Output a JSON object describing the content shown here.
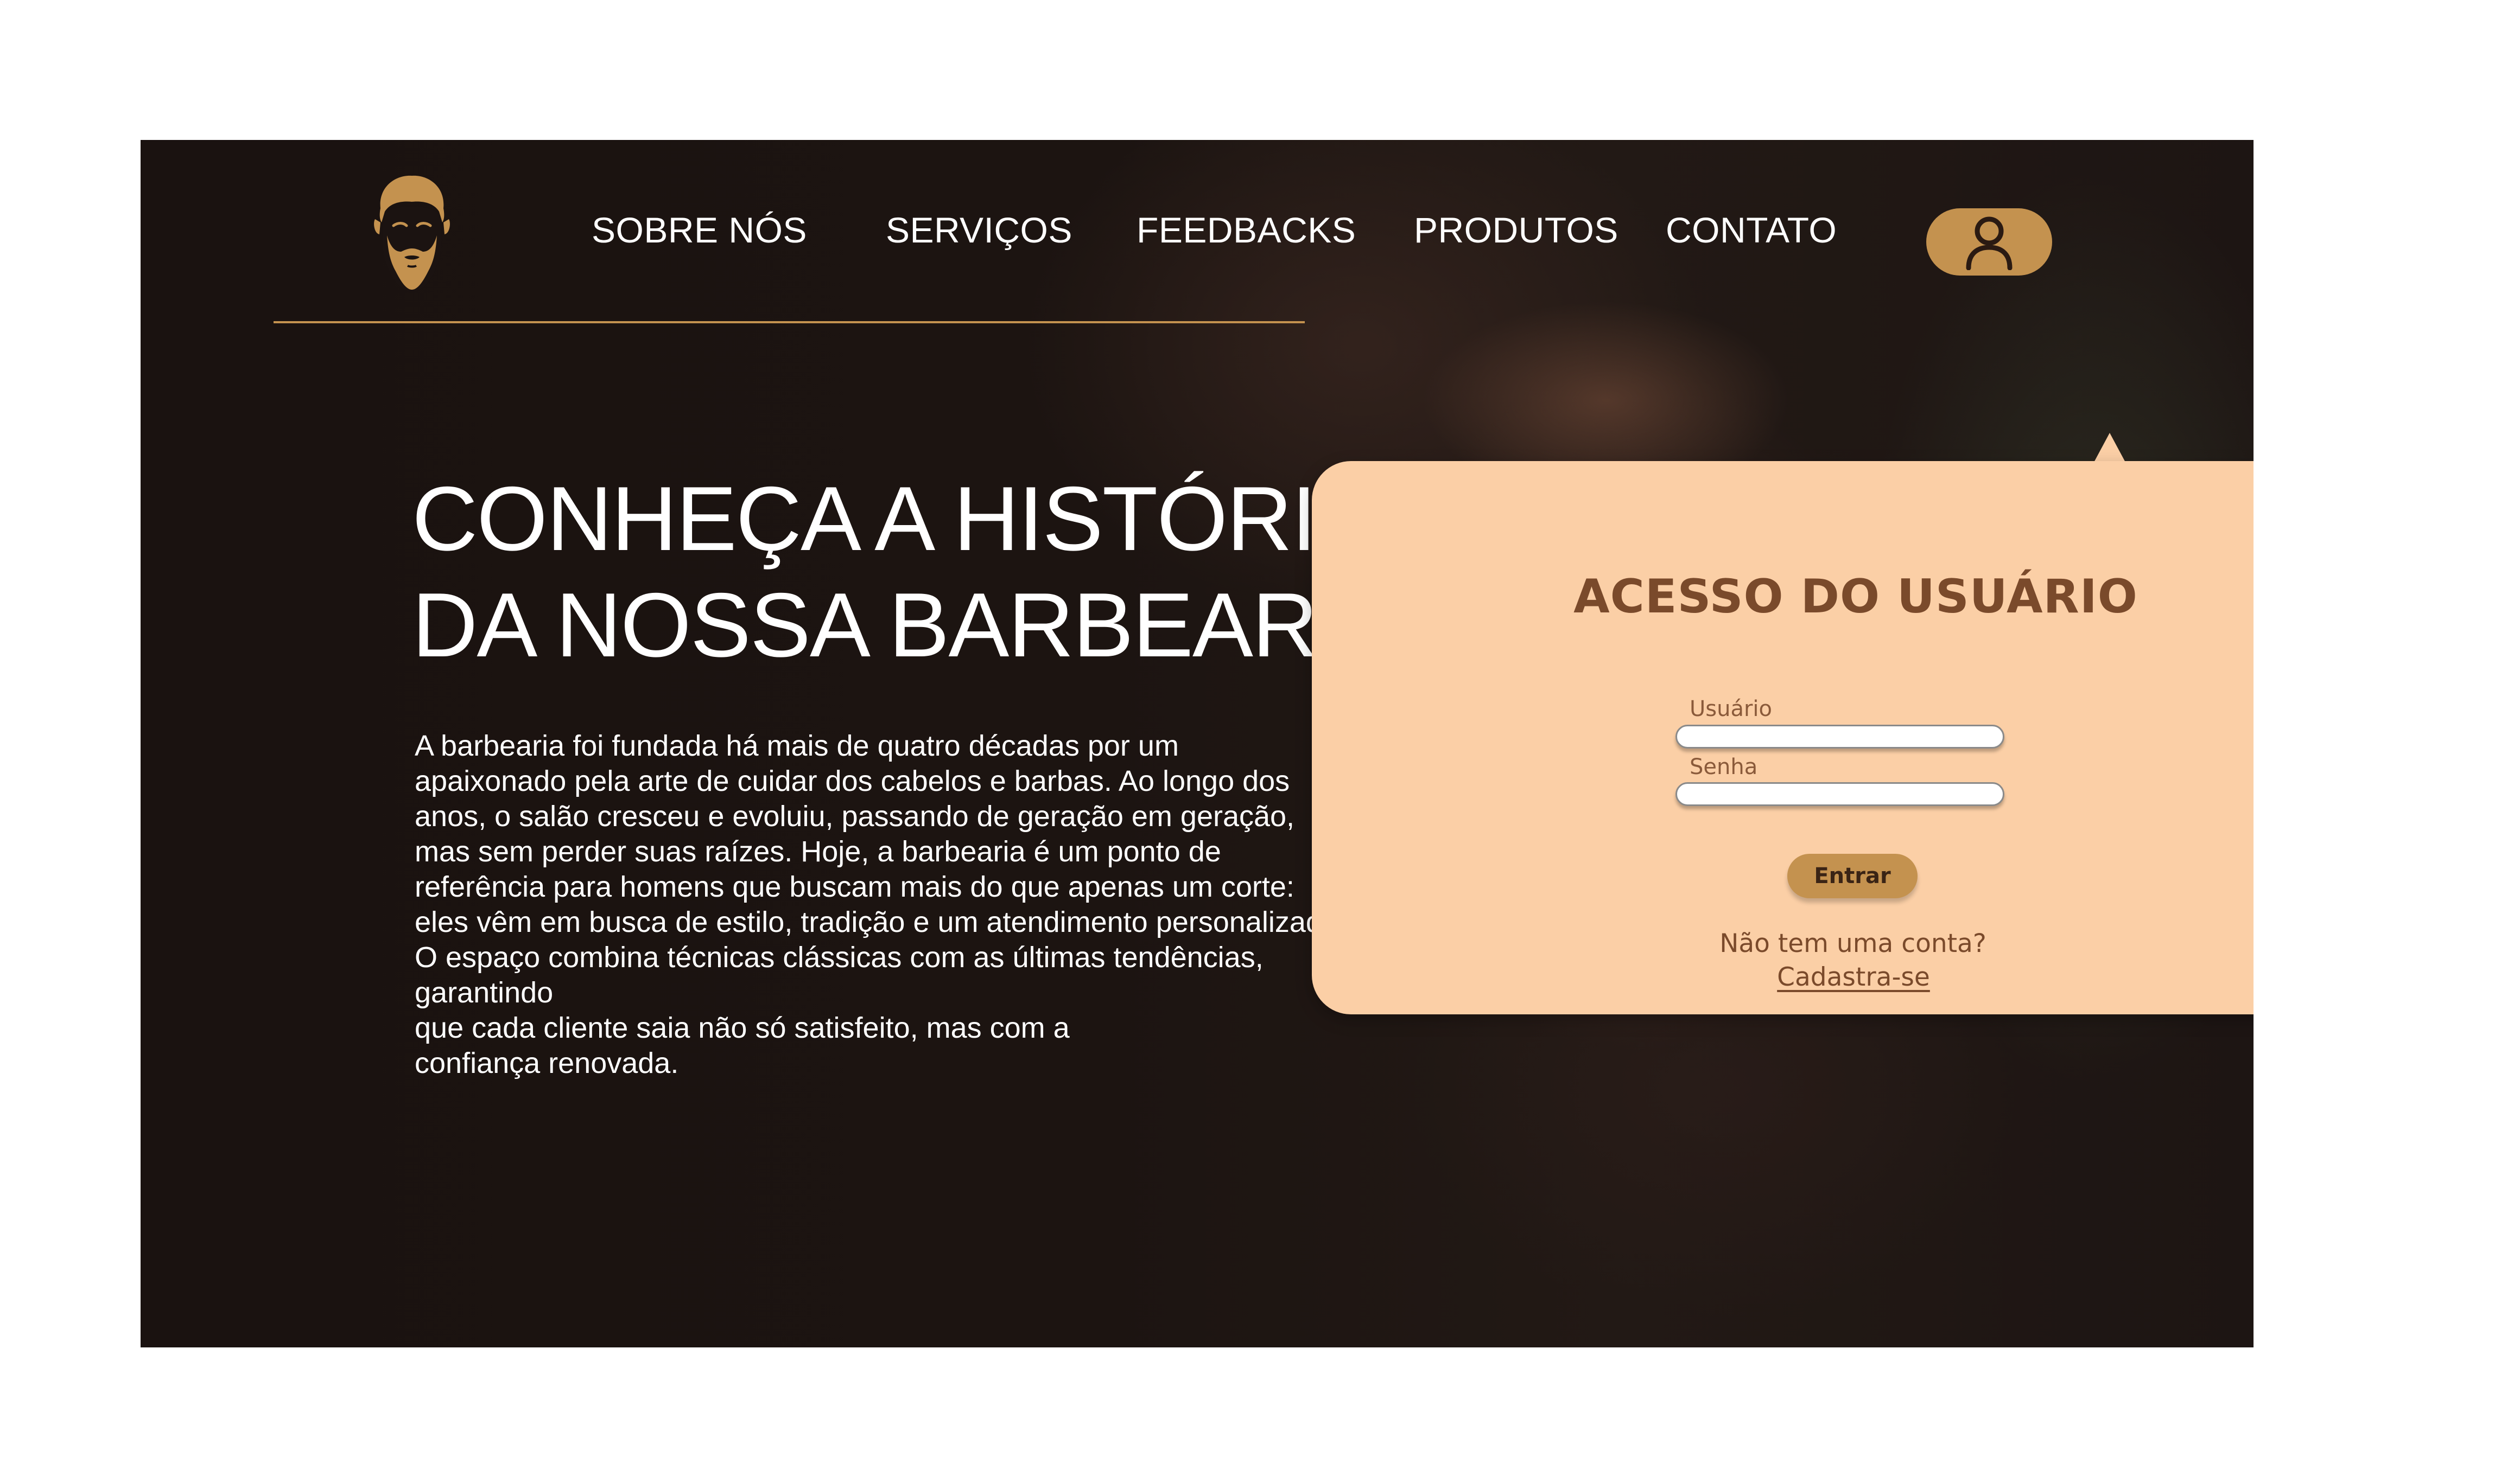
{
  "nav": {
    "items": [
      {
        "label": "SOBRE NÓS"
      },
      {
        "label": "SERVIÇOS"
      },
      {
        "label": "FEEDBACKS"
      },
      {
        "label": "PRODUTOS"
      },
      {
        "label": "CONTATO"
      }
    ],
    "user_icon": "user-icon",
    "logo_icon": "bearded-man-logo"
  },
  "hero": {
    "title_lines": [
      "CONHEÇA A HISTÓRIA",
      "DA NOSSA BARBEARIA"
    ],
    "paragraph_lines": [
      "A barbearia foi fundada há mais de quatro décadas por um",
      "apaixonado pela arte de cuidar dos cabelos e barbas. Ao longo dos",
      "anos, o salão cresceu e evoluiu, passando de geração em geração,",
      "mas sem perder suas raízes. Hoje, a barbearia é um ponto de",
      "referência para homens que buscam mais do que apenas um corte:",
      "eles vêm em busca de estilo, tradição e um atendimento personalizado.",
      "O espaço combina técnicas clássicas com as últimas tendências,",
      "garantindo",
      "que cada cliente saia não só satisfeito, mas com a",
      "confiança renovada."
    ]
  },
  "login": {
    "title": "ACESSO DO USUÁRIO",
    "user_label": "Usuário",
    "user_value": "",
    "password_label": "Senha",
    "password_value": "",
    "enter_label": "Entrar",
    "no_account_text": "Não tem uma conta?",
    "signup_label": "Cadastra-se"
  },
  "colors": {
    "accent": "#c4924f",
    "popup_bg": "#fbcfa6",
    "popup_text": "#7a4a2b",
    "page_bg": "#1b1311"
  }
}
